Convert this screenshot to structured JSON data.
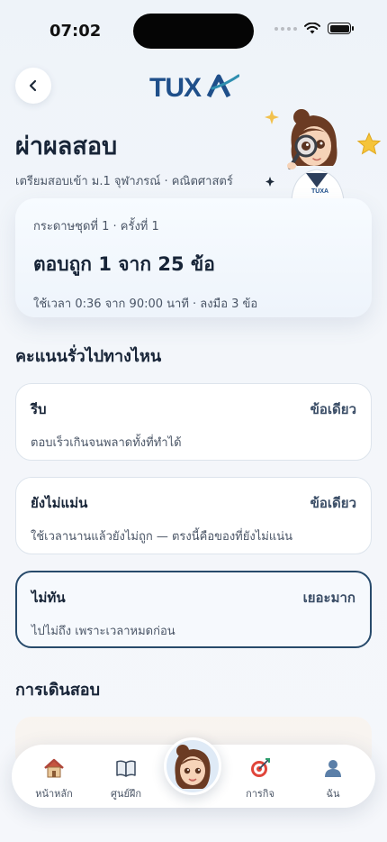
{
  "status_bar": {
    "time": "07:02"
  },
  "header": {
    "logo_text": "TUXA",
    "title": "ผ่าผลสอบ",
    "subtitle": "เตรียมสอบเข้า ม.1 จุฬาภรณ์ · คณิตศาสตร์"
  },
  "summary": {
    "sheet_label": "กระดาษชุดที่ 1 · ครั้งที่ 1",
    "score": "ตอบถูก 1 จาก 25 ข้อ",
    "time": "ใช้เวลา 0:36 จาก 90:00 นาที · ลงมือ 3 ข้อ"
  },
  "misses": {
    "title": "คะแนนรั่วไปทางไหน",
    "items": [
      {
        "name": "รีบ",
        "amount": "ข้อเดียว",
        "desc": "ตอบเร็วเกินจนพลาดทั้งที่ทำได้"
      },
      {
        "name": "ยังไม่แม่น",
        "amount": "ข้อเดียว",
        "desc": "ใช้เวลานานแล้วยังไม่ถูก — ตรงนี้คือของที่ยังไม่แน่น"
      },
      {
        "name": "ไม่ทัน",
        "amount": "เยอะมาก",
        "desc": "ไปไม่ถึง เพราะเวลาหมดก่อน"
      }
    ]
  },
  "journey": {
    "title": "การเดินสอบ"
  },
  "tabs": [
    {
      "label": "หน้าหลัก",
      "icon": "home-icon"
    },
    {
      "label": "ศูนย์ฝึก",
      "icon": "book-icon"
    },
    {
      "label": "การกิจ",
      "icon": "target-icon"
    },
    {
      "label": "ฉัน",
      "icon": "person-icon"
    }
  ],
  "colors": {
    "accent": "#274a6b",
    "logo_blue": "#1f4f8a",
    "logo_accent": "#2f8fb0"
  }
}
